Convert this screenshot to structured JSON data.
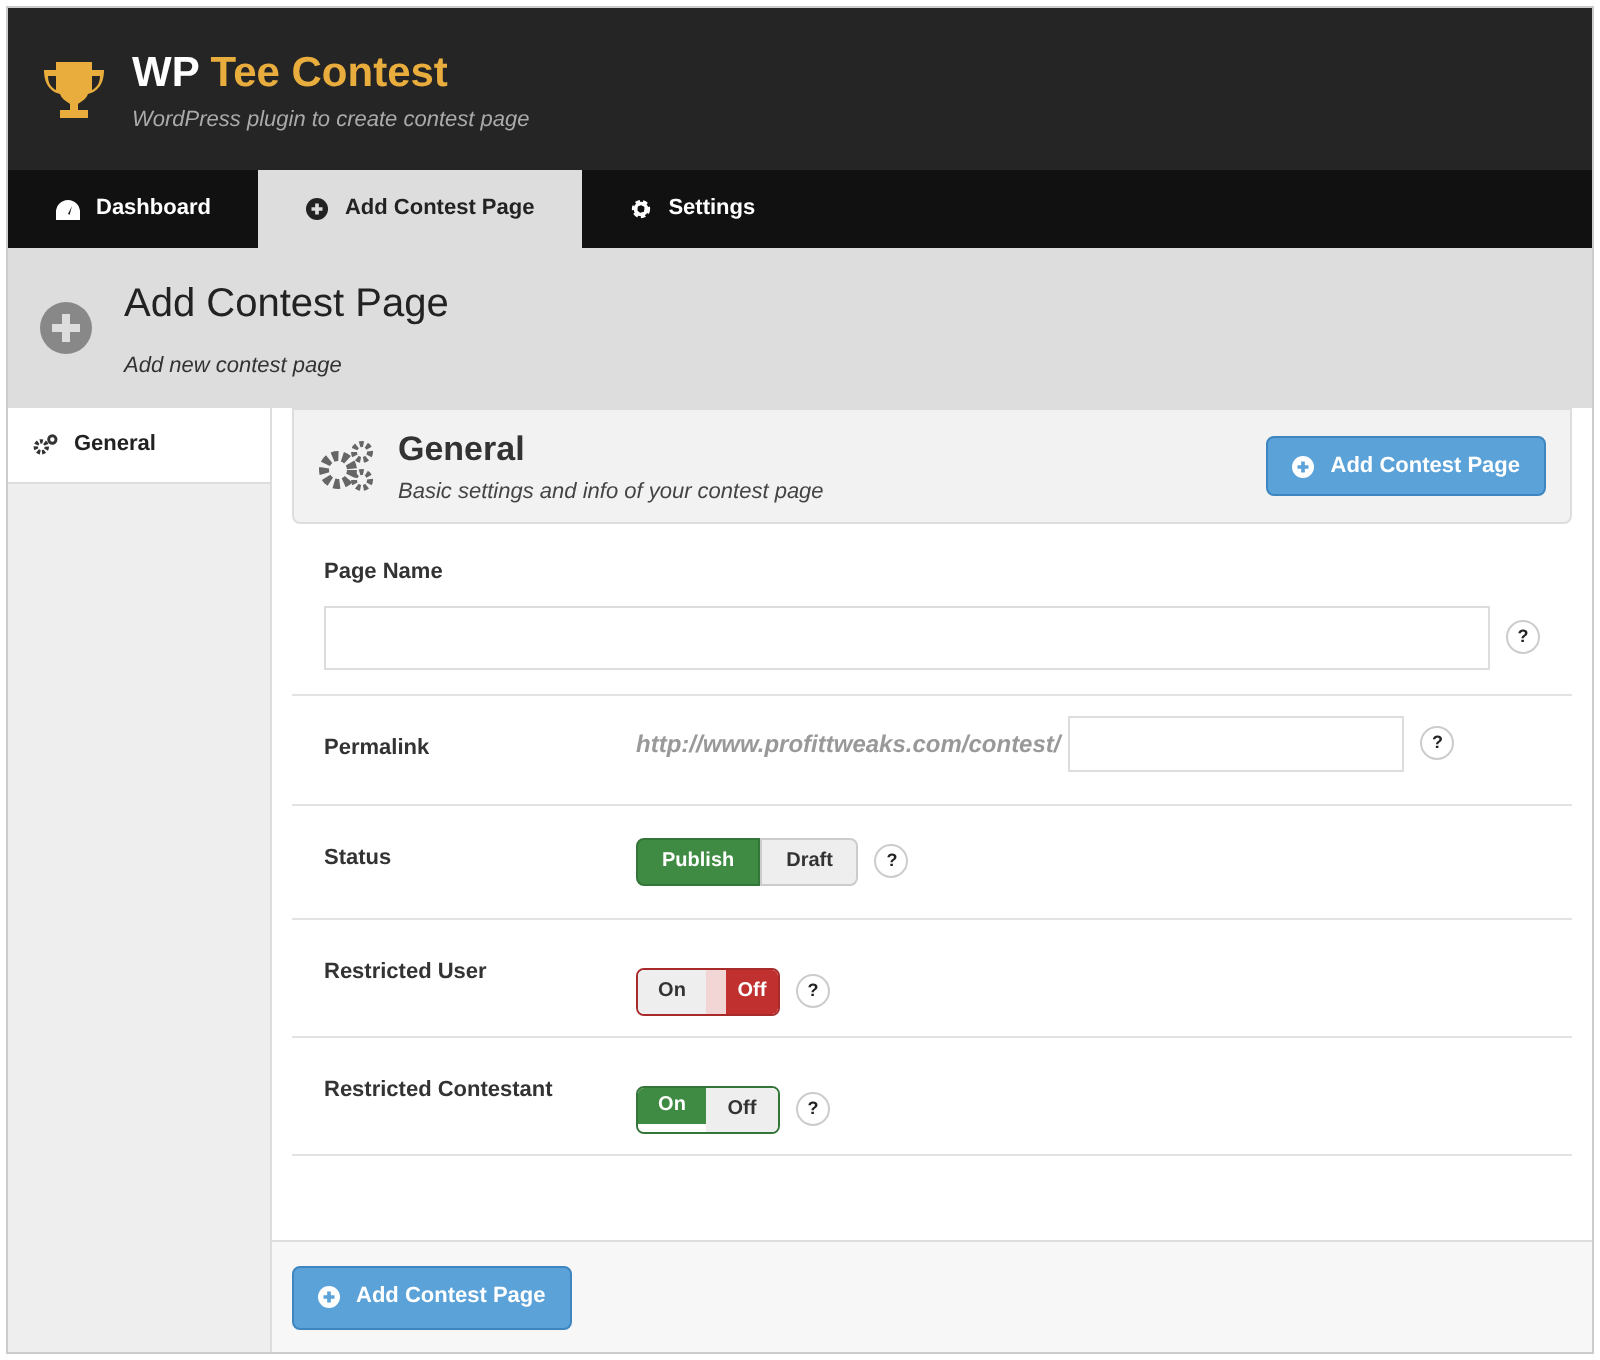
{
  "app": {
    "title_prefix": "WP",
    "title_main": "Tee Contest",
    "subtitle": "WordPress plugin to create contest page"
  },
  "tabs": [
    {
      "label": "Dashboard",
      "kind": "dashboard",
      "selected": false
    },
    {
      "label": "Add Contest Page",
      "kind": "add",
      "selected": true
    },
    {
      "label": "Settings",
      "kind": "settings",
      "selected": false
    }
  ],
  "page_header": {
    "title": "Add Contest Page",
    "subtitle": "Add new contest page"
  },
  "sidebar": {
    "items": [
      {
        "label": "General",
        "selected": true
      }
    ]
  },
  "section": {
    "title": "General",
    "subtitle": "Basic settings and info of your contest page",
    "button": "Add Contest Page"
  },
  "fields": [
    {
      "kind": "text",
      "label": "Page Name",
      "help": "?"
    },
    {
      "kind": "permalink",
      "label": "Permalink",
      "prefix": "http://www.profittweaks.com/contest/",
      "help": "?"
    },
    {
      "kind": "segmented",
      "label": "Status",
      "options": [
        {
          "label": "Publish",
          "selected": true
        },
        {
          "label": "Draft",
          "selected": false
        }
      ],
      "help": "?"
    },
    {
      "kind": "toggle",
      "label": "Restricted User",
      "on_label": "On",
      "off_label": "Off",
      "on": false,
      "help": "?"
    },
    {
      "kind": "toggle",
      "label": "Restricted Contestant",
      "on_label": "On",
      "off_label": "Off",
      "on": true,
      "help": "?"
    }
  ],
  "footer_button": "Add Contest Page"
}
